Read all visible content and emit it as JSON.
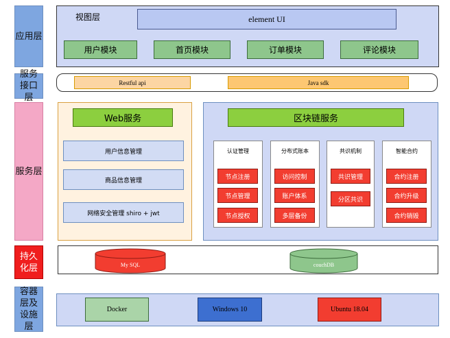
{
  "layers": {
    "app": "应用层",
    "service_api": "服务接口层",
    "service": "服务层",
    "persistence": "持久化层",
    "infra": "容器层及设施层"
  },
  "app_layer": {
    "view_label": "视图层",
    "element_ui": "element UI",
    "modules": [
      "用户模块",
      "首页模块",
      "订单模块",
      "评论模块"
    ]
  },
  "api_layer": {
    "restful": "Restful api",
    "java_sdk": "Java sdk"
  },
  "web_service": {
    "title": "Web服务",
    "items": [
      "用户信息管理",
      "商品信息管理",
      "网络安全管理 shiro + jwt"
    ]
  },
  "blockchain_service": {
    "title": "区块链服务",
    "columns": [
      {
        "title": "认证管理",
        "items": [
          "节点注册",
          "节点管理",
          "节点授权"
        ]
      },
      {
        "title": "分布式账本",
        "items": [
          "访问控制",
          "账户体系",
          "多层备份"
        ]
      },
      {
        "title": "共识机制",
        "items": [
          "共识管理",
          "分区共识"
        ]
      },
      {
        "title": "智能合约",
        "items": [
          "合约注册",
          "合约升级",
          "合约销毁"
        ]
      }
    ]
  },
  "persistence": {
    "mysql": "My SQL",
    "couchdb": "couchDB"
  },
  "infra": {
    "docker": "Docker",
    "windows": "Windows 10",
    "ubuntu": "Ubuntu 18.04"
  },
  "colors": {
    "blue_label": "#7ea6e0",
    "pink_label": "#f4a8c6",
    "red_label": "#f01e1e",
    "panel_blue": "#cfd8f5",
    "green": "#8ec68c",
    "orange": "#fcd5a3",
    "lime": "#8ccf3f",
    "red": "#f23d30"
  }
}
